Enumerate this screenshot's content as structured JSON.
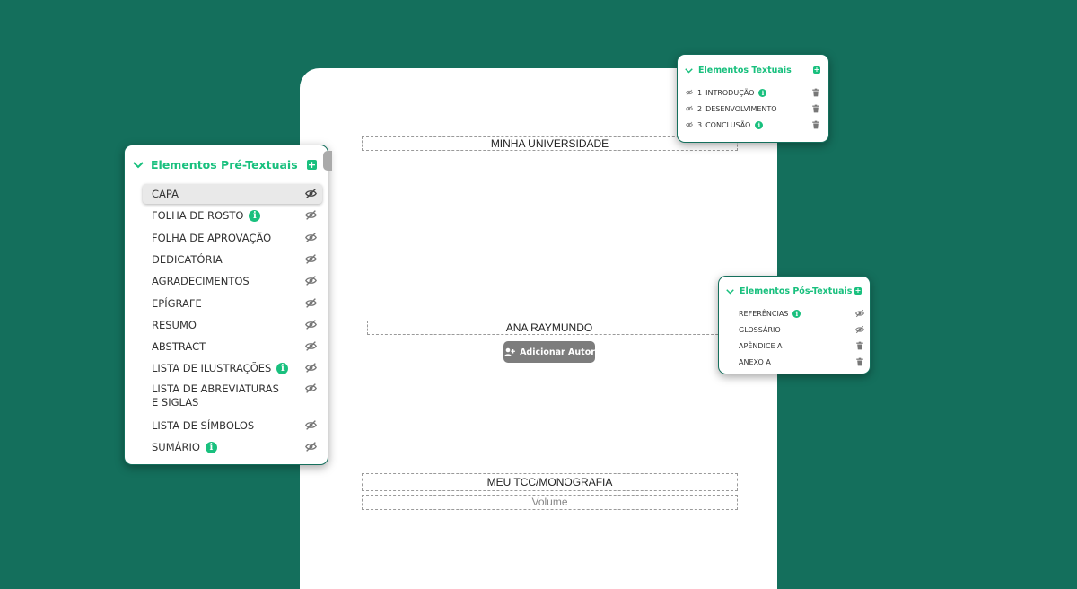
{
  "document": {
    "university": "MINHA UNIVERSIDADE",
    "author": "ANA RAYMUNDO",
    "add_author_label": "Adicionar Autor",
    "title": "MEU TCC/MONOGRAFIA",
    "volume_placeholder": "Volume"
  },
  "pre_textual": {
    "header": "Elementos Pré-Textuais",
    "items": [
      {
        "label": "CAPA",
        "info": false,
        "icon": "eye-off-icon",
        "selected": true
      },
      {
        "label": "FOLHA DE ROSTO",
        "info": true,
        "icon": "eye-off-icon"
      },
      {
        "label": "FOLHA DE APROVAÇÃO",
        "info": false,
        "icon": "eye-off-icon"
      },
      {
        "label": "DEDICATÓRIA",
        "info": false,
        "icon": "eye-off-icon"
      },
      {
        "label": "AGRADECIMENTOS",
        "info": false,
        "icon": "eye-off-icon"
      },
      {
        "label": "EPÍGRAFE",
        "info": false,
        "icon": "eye-off-icon"
      },
      {
        "label": "RESUMO",
        "info": false,
        "icon": "eye-off-icon"
      },
      {
        "label": "ABSTRACT",
        "info": false,
        "icon": "eye-off-icon"
      },
      {
        "label": "LISTA DE ILUSTRAÇÕES",
        "info": true,
        "icon": "eye-off-icon"
      },
      {
        "label": "LISTA DE ABREVIATURAS E SIGLAS",
        "info": false,
        "icon": "eye-off-icon"
      },
      {
        "label": "LISTA DE SÍMBOLOS",
        "info": false,
        "icon": "eye-off-icon"
      },
      {
        "label": "SUMÁRIO",
        "info": true,
        "icon": "eye-off-icon"
      }
    ]
  },
  "textual": {
    "header": "Elementos Textuais",
    "items": [
      {
        "number": "1",
        "label": "INTRODUÇÃO",
        "info": true,
        "icon": "trash-icon"
      },
      {
        "number": "2",
        "label": "DESENVOLVIMENTO",
        "info": false,
        "icon": "trash-icon"
      },
      {
        "number": "3",
        "label": "CONCLUSÃO",
        "info": true,
        "icon": "trash-icon"
      }
    ]
  },
  "post_textual": {
    "header": "Elementos Pós-Textuais",
    "items": [
      {
        "label": "REFERÊNCIAS",
        "info": true,
        "icon": "eye-off-icon"
      },
      {
        "label": "GLOSSÁRIO",
        "info": false,
        "icon": "eye-off-icon"
      },
      {
        "label": "APÊNDICE A",
        "info": false,
        "icon": "trash-icon"
      },
      {
        "label": "ANEXO A",
        "info": false,
        "icon": "trash-icon"
      }
    ]
  },
  "colors": {
    "background": "#146f5c",
    "accent": "#19c07e",
    "button": "#7d7d7d"
  }
}
